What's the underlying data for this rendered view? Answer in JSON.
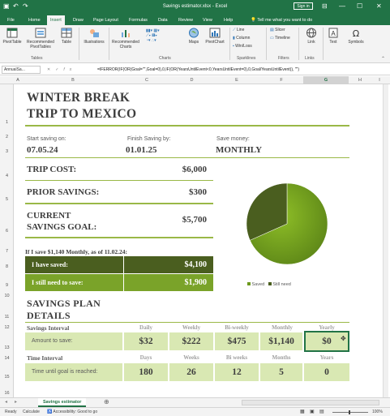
{
  "window": {
    "title": "Savings estimator.xlsx  -  Excel",
    "sign_in": "Sign in"
  },
  "tabs": [
    "File",
    "Home",
    "Insert",
    "Draw",
    "Page Layout",
    "Formulas",
    "Data",
    "Review",
    "View",
    "Help"
  ],
  "tell_me": "Tell me what you want to do",
  "ribbon": {
    "pivottable": "PivotTable",
    "recommended_pivot": "Recommended PivotTables",
    "table": "Table",
    "illustrations": "Illustrations",
    "recommended_charts": "Recommended Charts",
    "maps": "Maps",
    "pivotchart": "PivotChart",
    "line": "Line",
    "column": "Column",
    "winloss": "Win/Loss",
    "slicer": "Slicer",
    "timeline": "Timeline",
    "link": "Link",
    "text": "Text",
    "symbols": "Symbols",
    "group_tables": "Tables",
    "group_charts": "Charts",
    "group_sparklines": "Sparklines",
    "group_filters": "Filters",
    "group_links": "Links"
  },
  "formula_bar": {
    "name_box": "AnnualSa...",
    "formula": "=IFERROR(IF(OR(Goal=\"\",Goal=0),0,IF(OR(YearsUntilEvent<0,YearsUntilEvent=0),0,Goal/YearsUntilEvent)), \"\")"
  },
  "columns": [
    "A",
    "B",
    "C",
    "D",
    "E",
    "F",
    "G",
    "H",
    "I"
  ],
  "rows": [
    "1",
    "2",
    "3",
    "4",
    "5",
    "6",
    "7",
    "8",
    "9",
    "10",
    "11",
    "12",
    "13",
    "14",
    "15",
    "16"
  ],
  "sheet": {
    "title_line1": "WINTER BREAK",
    "title_line2": "TRIP TO MEXICO",
    "start_label": "Start saving on:",
    "start_date": "07.05.24",
    "finish_label": "Finish Saving by:",
    "finish_date": "01.01.25",
    "save_money_label": "Save money:",
    "frequency": "MONTHLY",
    "trip_cost_label": "TRIP COST:",
    "trip_cost": "$6,000",
    "prior_savings_label": "PRIOR SAVINGS:",
    "prior_savings": "$300",
    "current_goal_line1": "CURRENT",
    "current_goal_line2": "SAVINGS GOAL:",
    "current_goal": "$5,700",
    "summary_line": "If I save $1,140 Monthly, as of 11.02.24:",
    "saved_label": "I have saved:",
    "saved_value": "$4,100",
    "need_label": "I still need to save:",
    "need_value": "$1,900",
    "plan_line1": "SAVINGS PLAN",
    "plan_line2": "DETAILS",
    "interval_label": "Savings Interval",
    "interval_headers": [
      "Daily",
      "Weekly",
      "Bi-weekly",
      "Monthly",
      "Yearly"
    ],
    "amount_label": "Amount to save:",
    "amounts": [
      "$32",
      "$222",
      "$475",
      "$1,140",
      "$0"
    ],
    "time_label": "Time Interval",
    "time_headers": [
      "Days",
      "Weeks",
      "Bi weeks",
      "Months",
      "Years"
    ],
    "until_label": "Time until goal is reached:",
    "time_values": [
      "180",
      "26",
      "12",
      "5",
      "0"
    ]
  },
  "chart_data": {
    "type": "pie",
    "categories": [
      "Saved",
      "Still need"
    ],
    "values": [
      4100,
      1900
    ],
    "colors": [
      "#6e9a1e",
      "#4a5e1f"
    ],
    "legend": "bottom"
  },
  "sheet_tab": "Savings estimator",
  "status": {
    "ready": "Ready",
    "calc": "Calculate",
    "accessibility": "Accessibility: Good to go",
    "zoom": "100%"
  },
  "colors": {
    "excel_green": "#217346",
    "dark_olive": "#4a5e1f",
    "olive": "#7aa329",
    "light_green": "#d9e8b3"
  }
}
